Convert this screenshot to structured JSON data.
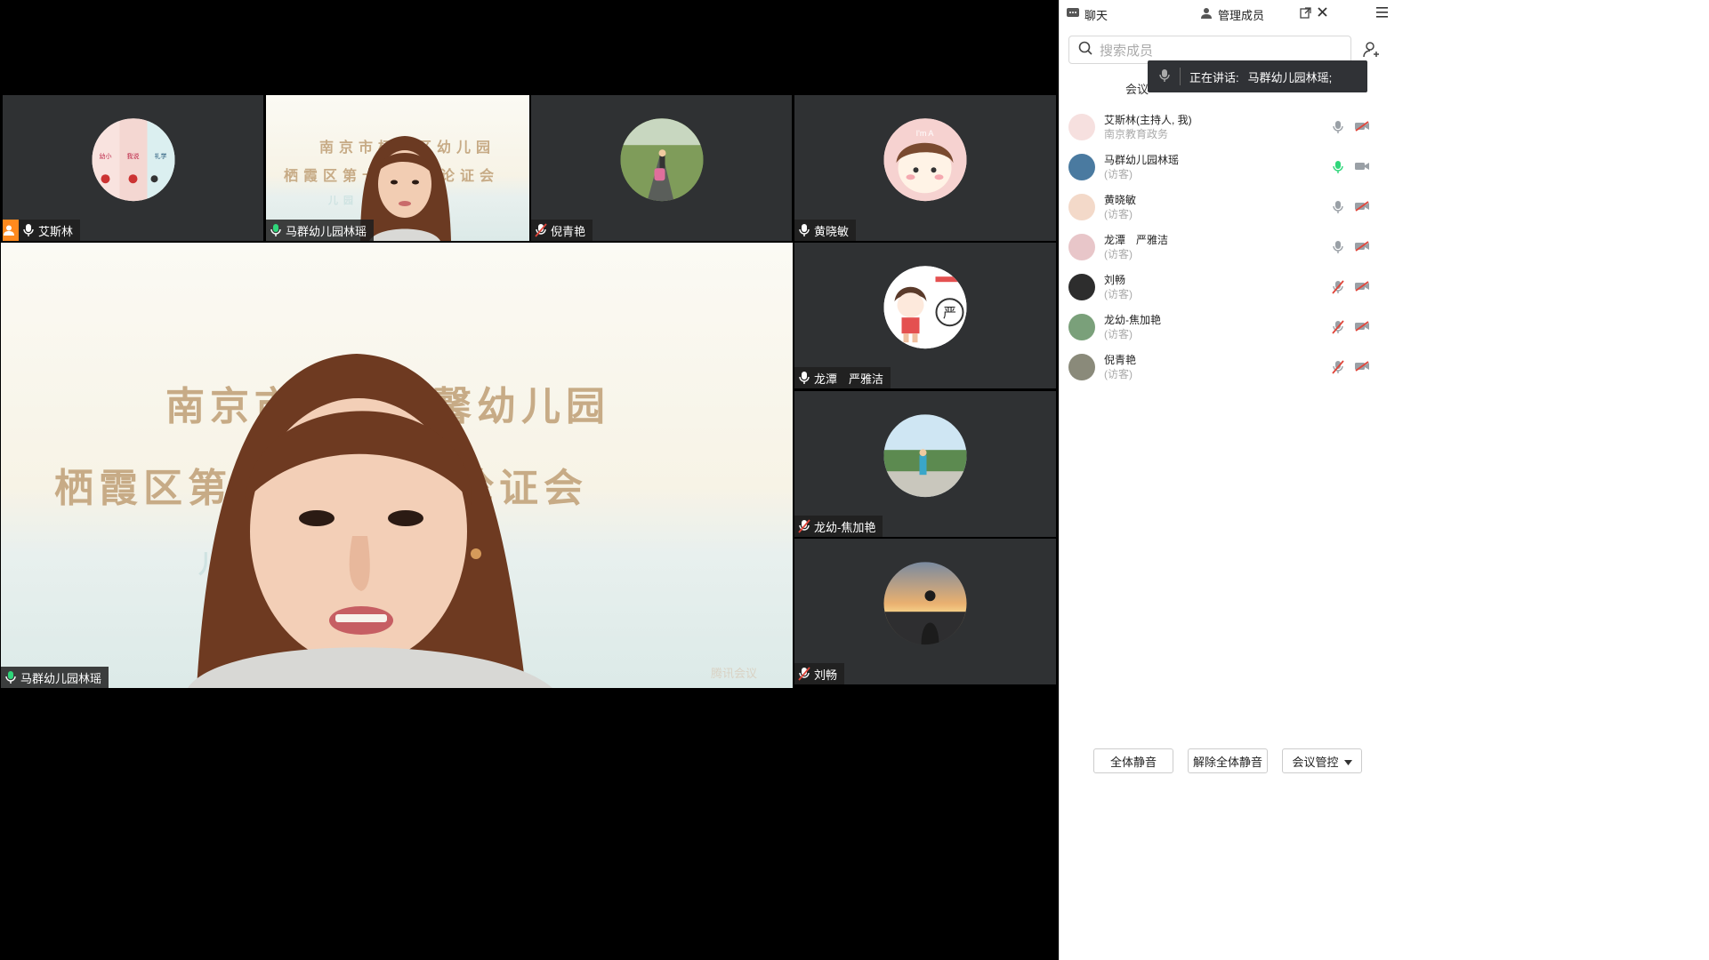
{
  "tiles": {
    "t1": {
      "name": "艾斯林"
    },
    "t2": {
      "name": "马群幼儿园林瑶"
    },
    "t3": {
      "name": "倪青艳"
    },
    "t4": {
      "name": "黄晓敏"
    },
    "t5": {
      "name": "龙潭　严雅洁"
    },
    "t6": {
      "name": "龙幼-焦加艳"
    },
    "t7": {
      "name": "刘畅"
    },
    "main": {
      "name": "马群幼儿园林瑶",
      "banner_line1": "南京市栖霞区馨幼儿园",
      "banner_line2": "栖霞区第十三届开题论证会",
      "banner_line3": "儿园",
      "watermark": "腾讯会议"
    }
  },
  "thumb_banner": {
    "line1": "南京市栖霞区幼儿园",
    "line2": "栖霞区第十三开题论证会",
    "line3": "儿园"
  },
  "avatar_text": {
    "t4": "I'm A"
  },
  "sidebar": {
    "chat_tab": "聊天",
    "manage_tab": "管理成员",
    "search_placeholder": "搜索成员",
    "meeting_label": "会议",
    "speaking_prefix": "正在讲话:",
    "speaking_name": "马群幼儿园林瑶;",
    "members": [
      {
        "name": "艾斯林(主持人, 我)",
        "sub": "南京教育政务",
        "mic": "on",
        "cam": "off"
      },
      {
        "name": "马群幼儿园林瑶",
        "sub": "(访客)",
        "mic": "active",
        "cam": "on"
      },
      {
        "name": "黄晓敏",
        "sub": "(访客)",
        "mic": "on",
        "cam": "off"
      },
      {
        "name": "龙潭　严雅洁",
        "sub": "(访客)",
        "mic": "on",
        "cam": "off"
      },
      {
        "name": "刘畅",
        "sub": "(访客)",
        "mic": "muted",
        "cam": "off"
      },
      {
        "name": "龙幼-焦加艳",
        "sub": "(访客)",
        "mic": "muted",
        "cam": "off"
      },
      {
        "name": "倪青艳",
        "sub": "(访客)",
        "mic": "muted",
        "cam": "off"
      }
    ],
    "buttons": {
      "mute_all": "全体静音",
      "unmute_all": "解除全体静音",
      "controls": "会议管控"
    }
  },
  "colors": {
    "accent": "#2fd67a",
    "muted": "#e0453a",
    "host": "#ff8a1e",
    "tile_bg": "#2f3133"
  }
}
